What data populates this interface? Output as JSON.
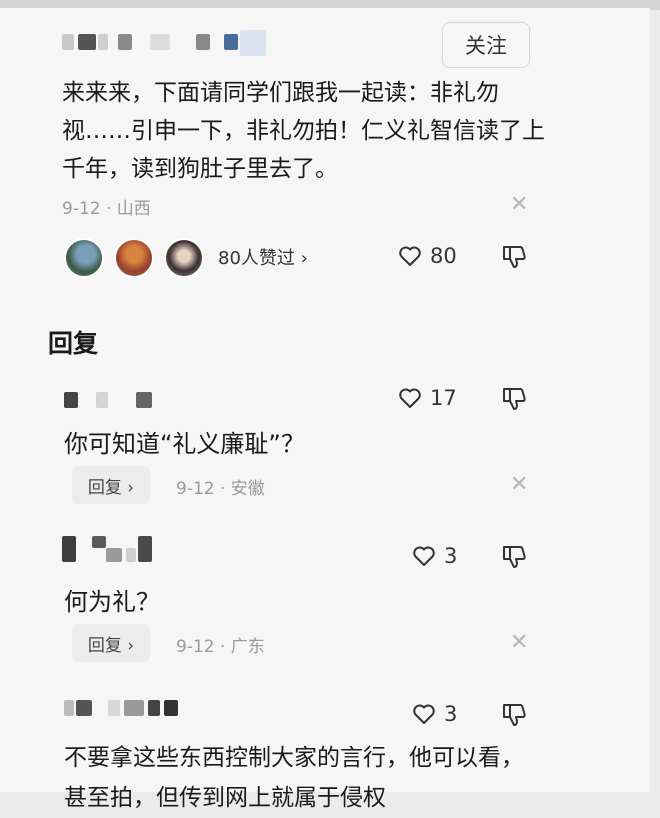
{
  "post": {
    "follow_label": "关注",
    "text": "来来来，下面请同学们跟我一起读：非礼勿视……引申一下，非礼勿拍！仁义礼智信读了上千年，读到狗肚子里去了。",
    "meta": "9-12 · 山西",
    "likers_label": "80人赞过 ›",
    "like_count": "80"
  },
  "replies_section": {
    "title": "回复",
    "items": [
      {
        "text": "你可知道“礼义廉耻”？",
        "like_count": "17",
        "reply_label": "回复 ›",
        "meta": "9-12 · 安徽"
      },
      {
        "text": "何为礼？",
        "like_count": "3",
        "reply_label": "回复 ›",
        "meta": "9-12 · 广东"
      },
      {
        "text": "不要拿这些东西控制大家的言行，他可以看，甚至拍，但传到网上就属于侵权",
        "like_count": "3"
      }
    ]
  },
  "icons": {
    "like": "heart-outline-icon",
    "dislike": "thumbs-down-icon",
    "close": "close-x-icon"
  },
  "colors": {
    "background": "#f6f6f6",
    "text": "#1a1a1a",
    "meta": "#9a9a9a"
  }
}
